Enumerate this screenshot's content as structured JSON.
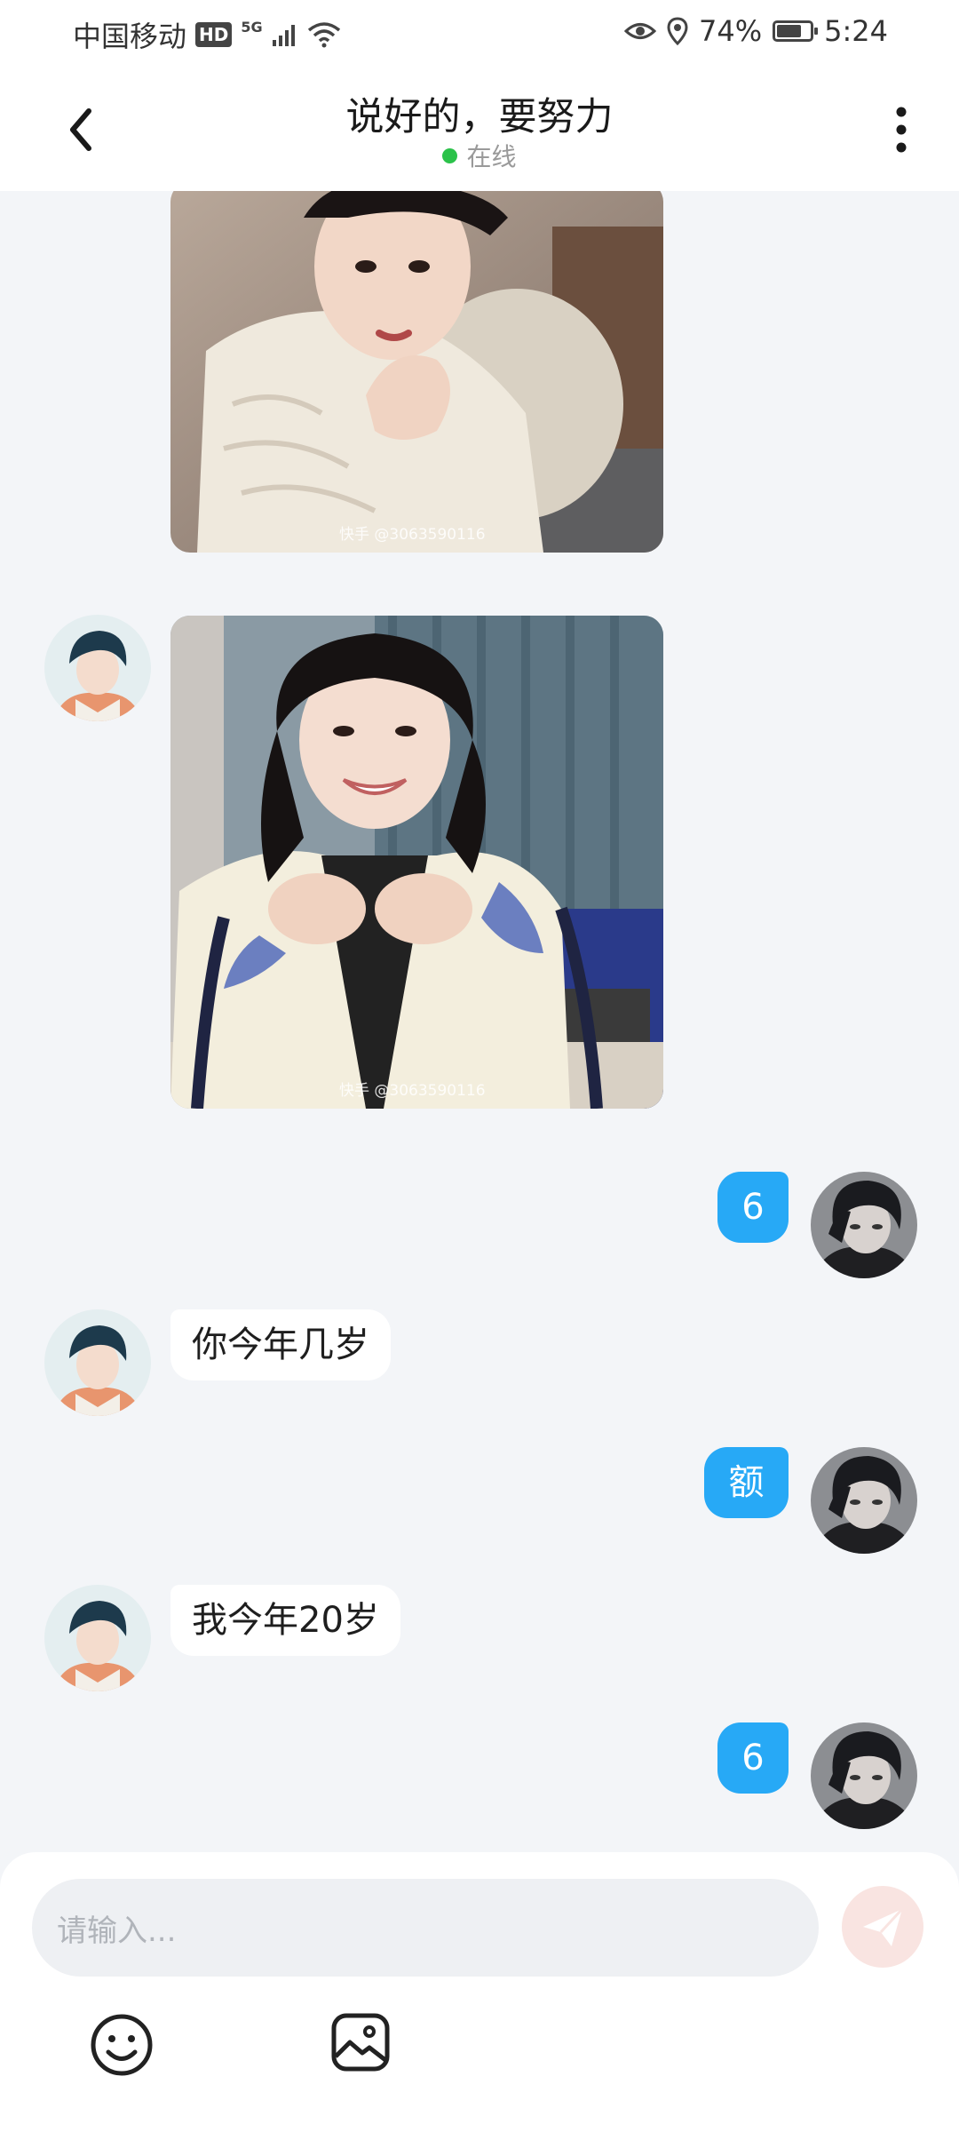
{
  "status_bar": {
    "carrier": "中国移动",
    "hd": "HD",
    "network": "5G",
    "battery": "74%",
    "battery_level": 0.74,
    "time": "5:24"
  },
  "header": {
    "title": "说好的，要努力",
    "status": "在线"
  },
  "messages": [
    {
      "side": "left",
      "type": "image",
      "watermark": "快手 @3063590116"
    },
    {
      "side": "left",
      "type": "image",
      "watermark": "快手 @3063590116"
    },
    {
      "side": "right",
      "type": "text",
      "text": "6"
    },
    {
      "side": "left",
      "type": "text",
      "text": "你今年几岁"
    },
    {
      "side": "right",
      "type": "text",
      "text": "额"
    },
    {
      "side": "left",
      "type": "text",
      "text": "我今年20岁"
    },
    {
      "side": "right",
      "type": "text",
      "text": "6"
    }
  ],
  "input": {
    "placeholder": "请输入..."
  },
  "icons": {
    "back": "back-arrow-icon",
    "more": "more-vertical-icon",
    "send": "send-icon",
    "emoji": "emoji-icon",
    "image": "image-icon"
  },
  "colors": {
    "accent": "#27a9f6",
    "online": "#2bc24a",
    "background": "#f3f5f8"
  }
}
